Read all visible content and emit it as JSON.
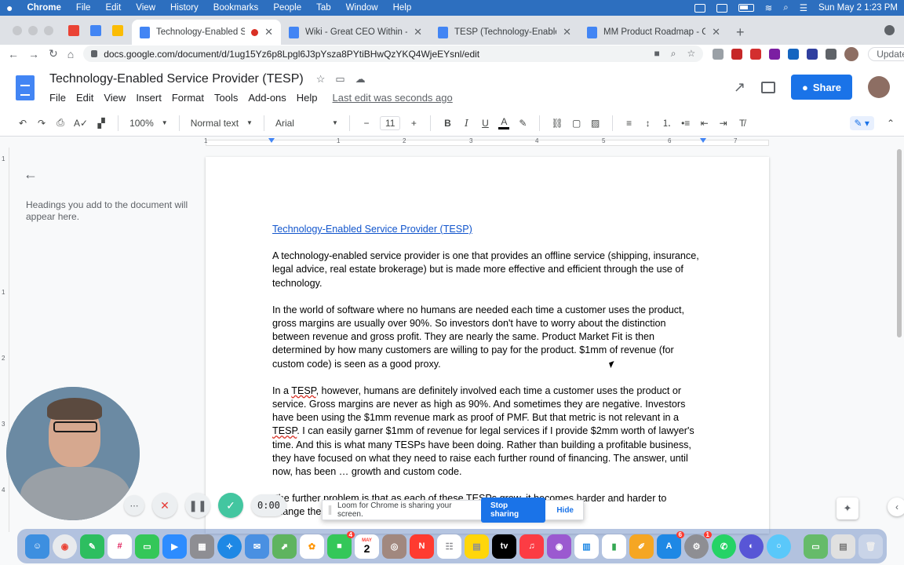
{
  "menubar": {
    "app": "Chrome",
    "items": [
      "File",
      "Edit",
      "View",
      "History",
      "Bookmarks",
      "People",
      "Tab",
      "Window",
      "Help"
    ],
    "clock": "Sun May 2  1:23 PM"
  },
  "browser": {
    "tabs": [
      {
        "title": "Technology-Enabled Servic",
        "active": true,
        "recording": true
      },
      {
        "title": "Wiki - Great CEO Within - Goo",
        "active": false
      },
      {
        "title": "TESP (Technology-Enabled Se",
        "active": false
      },
      {
        "title": "MM Product Roadmap - Googl",
        "active": false
      }
    ],
    "new_tab": "+",
    "url": "docs.google.com/document/d/1ug15Yz6p8Lpgl6J3pYsza8PYtiBHwQzYKQ4WjeEYsnl/edit",
    "update_label": "Update"
  },
  "docs": {
    "title": "Technology-Enabled Service Provider (TESP)",
    "menu": [
      "File",
      "Edit",
      "View",
      "Insert",
      "Format",
      "Tools",
      "Add-ons",
      "Help"
    ],
    "last_edit": "Last edit was seconds ago",
    "share_label": "Share",
    "toolbar": {
      "zoom": "100%",
      "style": "Normal text",
      "font": "Arial",
      "font_size": "11"
    },
    "ruler_numbers": [
      "1",
      "1",
      "2",
      "3",
      "4",
      "5",
      "6",
      "7"
    ],
    "vruler_numbers": [
      "1",
      "1",
      "2",
      "3",
      "4"
    ],
    "outline_message": "Headings you add to the document will appear here."
  },
  "document": {
    "heading": "Technology-Enabled Service Provider (TESP)",
    "p1": "A technology-enabled service provider is one that provides an offline service (shipping, insurance, legal advice, real estate brokerage) but is made more effective and efficient through the use of technology.",
    "p2": "In the world of software where no humans are needed each time a customer uses the product, gross margins are usually over 90%. So investors don't have to worry about the distinction between revenue and gross profit.  They are nearly the same.   Product Market Fit is then determined by how many customers are willing to pay for the product. $1mm of revenue (for custom code) is seen as a good proxy.",
    "p3_a": "In a ",
    "p3_tesp1": "TESP",
    "p3_b": ", however, humans are definitely involved each time a customer uses the product or service. Gross margins are never as high as 90%. And sometimes they are negative. Investors have been using the $1mm revenue mark as proof of PMF.  But that metric is not relevant in a ",
    "p3_tesp2": "TESP",
    "p3_c": ".  I can easily garner $1mm of revenue for legal services if I provide $2mm worth of lawyer's time. And this is what many TESPs have been doing. Rather than building a profitable business, they have focused on what they need to raise each further round of financing. The answer, until now, has been … growth and custom code.",
    "p4": "The further problem is that as each of these TESPs grow, it becomes harder and harder to change the                                                                                    building a company that loses more and more money."
  },
  "loom": {
    "timer": "0:00",
    "sharing_text": "Loom for Chrome is sharing your screen.",
    "stop_label": "Stop sharing",
    "hide_label": "Hide"
  },
  "dock": {
    "calendar_month": "MAY",
    "calendar_day": "2",
    "badges": {
      "facetime": "4",
      "appstore": "6",
      "settings": "1"
    }
  },
  "colors": {
    "accent": "#1a73e8",
    "link": "#1155cc",
    "menubar": "#2d6fbf"
  }
}
